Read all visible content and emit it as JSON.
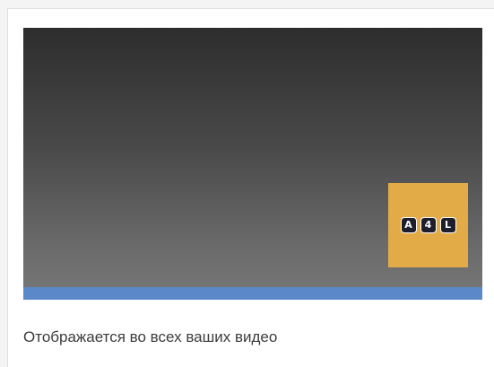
{
  "watermark": {
    "keys": [
      "A",
      "4",
      "L"
    ],
    "background": "#e3ab47"
  },
  "video": {
    "progress_fraction": 1.0,
    "progress_color": "#5b88c9"
  },
  "caption": "Отображается во всех ваших видео"
}
